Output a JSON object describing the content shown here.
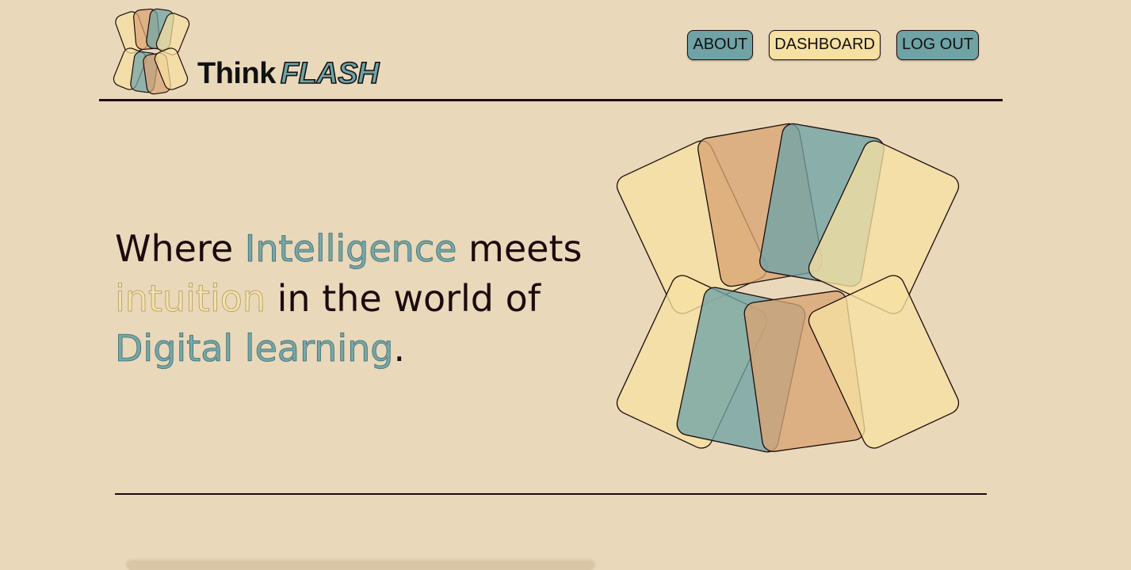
{
  "brand": {
    "name_part1": "Think",
    "name_part2": "FLASH"
  },
  "nav": {
    "about": "ABOUT",
    "dashboard": "DASHBOARD",
    "logout": "LOG OUT"
  },
  "hero": {
    "w1": "Where ",
    "w2": "Intelligence",
    "w3": " meets ",
    "w4": "intuition",
    "w5": " in the world of ",
    "w6": "Digital learning",
    "w7": "."
  },
  "colors": {
    "background": "#e9d8ba",
    "teal": "#6fa3a6",
    "cream": "#f6e0a2",
    "orange": "#d9a473",
    "ink": "#1c0b0d"
  },
  "icons": {
    "logo": "flash-cards-logo-icon",
    "art": "fanned-cards-illustration"
  }
}
